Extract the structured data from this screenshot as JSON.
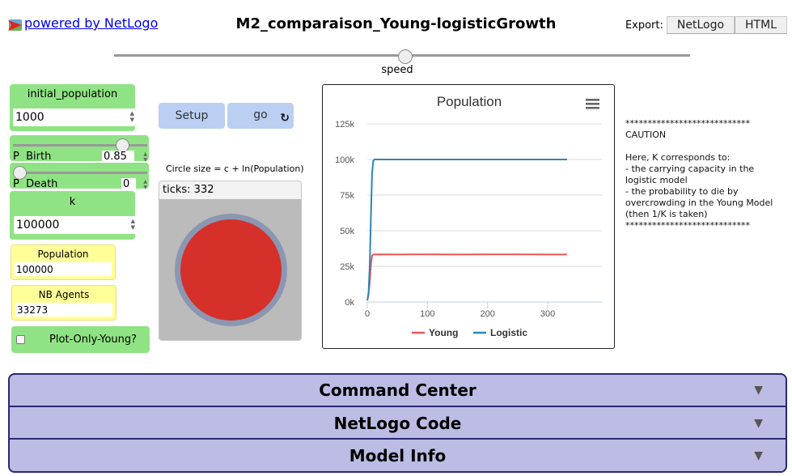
{
  "header": {
    "powered_by": "powered by NetLogo",
    "title": "M2_comparaison_Young-logisticGrowth",
    "export_label": "Export:",
    "export_buttons": [
      "NetLogo",
      "HTML"
    ]
  },
  "speed": {
    "label": "speed",
    "value": 0.5
  },
  "widgets": {
    "initial_population": {
      "label": "initial_population",
      "value": "1000"
    },
    "p_birth": {
      "label": "P  Birth",
      "value": "0.85",
      "fraction": 0.85
    },
    "p_death": {
      "label": "P  Death",
      "value": "0",
      "fraction": 0.0
    },
    "k": {
      "label": "k",
      "value": "100000"
    },
    "population_monitor": {
      "label": "Population",
      "value": "100000"
    },
    "nb_agents_monitor": {
      "label": "NB Agents",
      "value": "33273"
    },
    "plot_only_young": {
      "label": "Plot-Only-Young?",
      "checked": false
    },
    "setup_button": {
      "label": "Setup"
    },
    "go_button": {
      "label": "go",
      "forever_icon": "↻"
    },
    "circle_note": "Circle size = c + ln(Population)",
    "ticks": "ticks: 332"
  },
  "colors": {
    "young": "#e45652",
    "logistic": "#2e86b9",
    "widget_green": "#90e384",
    "monitor_yellow": "#ffff99",
    "button_blue": "#bacff2",
    "accordion": "#bcbce4"
  },
  "chart_data": {
    "type": "line",
    "title": "Population",
    "xlabel": "",
    "ylabel": "",
    "xlim": [
      0,
      390
    ],
    "ylim": [
      0,
      125000
    ],
    "x_ticks": [
      0,
      100,
      200,
      300
    ],
    "x_tick_labels": [
      "0",
      "100",
      "200",
      "300"
    ],
    "y_ticks": [
      0,
      25000,
      50000,
      75000,
      100000,
      125000
    ],
    "y_tick_labels": [
      "0k",
      "25k",
      "50k",
      "75k",
      "100k",
      "125k"
    ],
    "grid": true,
    "legend": "bottom",
    "series": [
      {
        "name": "Young",
        "color": "#e45652",
        "x": [
          0,
          2,
          4,
          6,
          8,
          10,
          15,
          50,
          100,
          150,
          200,
          250,
          300,
          332
        ],
        "y": [
          1000,
          5000,
          14000,
          26000,
          32500,
          33300,
          33400,
          33300,
          33400,
          33300,
          33350,
          33400,
          33300,
          33300
        ]
      },
      {
        "name": "Logistic",
        "color": "#2e86b9",
        "x": [
          0,
          2,
          4,
          6,
          8,
          10,
          12,
          20,
          100,
          200,
          300,
          332
        ],
        "y": [
          1000,
          6000,
          25000,
          60000,
          90000,
          99000,
          100000,
          100000,
          100000,
          100000,
          100000,
          100000
        ]
      }
    ]
  },
  "menu_icon": "hamburger-menu-icon",
  "caution_note": "****************************\nCAUTION\n\nHere, K corresponds to:\n- the carrying capacity in the\nlogistic model\n- the probability to die by\novercrowding in the Young Model\n(then 1/K is taken)\n****************************",
  "accordions": [
    {
      "label": "Command Center"
    },
    {
      "label": "NetLogo Code"
    },
    {
      "label": "Model Info"
    }
  ]
}
